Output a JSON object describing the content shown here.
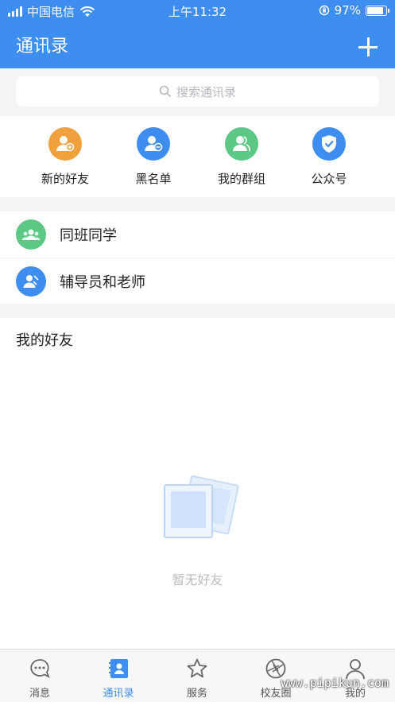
{
  "status": {
    "carrier": "中国电信",
    "time": "上午11:32",
    "battery": "97%",
    "battery_level": 0.97
  },
  "header": {
    "title": "通讯录"
  },
  "search": {
    "placeholder": "搜索通讯录"
  },
  "quick_actions": [
    {
      "label": "新的好友",
      "icon": "add-user-icon",
      "color": "#f0a03c"
    },
    {
      "label": "黑名单",
      "icon": "block-user-icon",
      "color": "#3d8ef0"
    },
    {
      "label": "我的群组",
      "icon": "group-icon",
      "color": "#5cc885"
    },
    {
      "label": "公众号",
      "icon": "shield-check-icon",
      "color": "#3d8ef0"
    }
  ],
  "groups": [
    {
      "label": "同班同学",
      "icon": "classmates-icon",
      "color": "#5cc885"
    },
    {
      "label": "辅导员和老师",
      "icon": "teacher-icon",
      "color": "#3d8ef0"
    }
  ],
  "friends": {
    "title": "我的好友",
    "empty_text": "暂无好友"
  },
  "tabs": [
    {
      "label": "消息",
      "icon": "message-icon"
    },
    {
      "label": "通讯录",
      "icon": "contacts-icon",
      "active": true
    },
    {
      "label": "服务",
      "icon": "star-icon"
    },
    {
      "label": "校友圈",
      "icon": "aperture-icon"
    },
    {
      "label": "我的",
      "icon": "person-icon"
    }
  ],
  "watermark": "www.pipikun.com",
  "colors": {
    "primary": "#3d8ef0",
    "background": "#f3f4f6"
  }
}
